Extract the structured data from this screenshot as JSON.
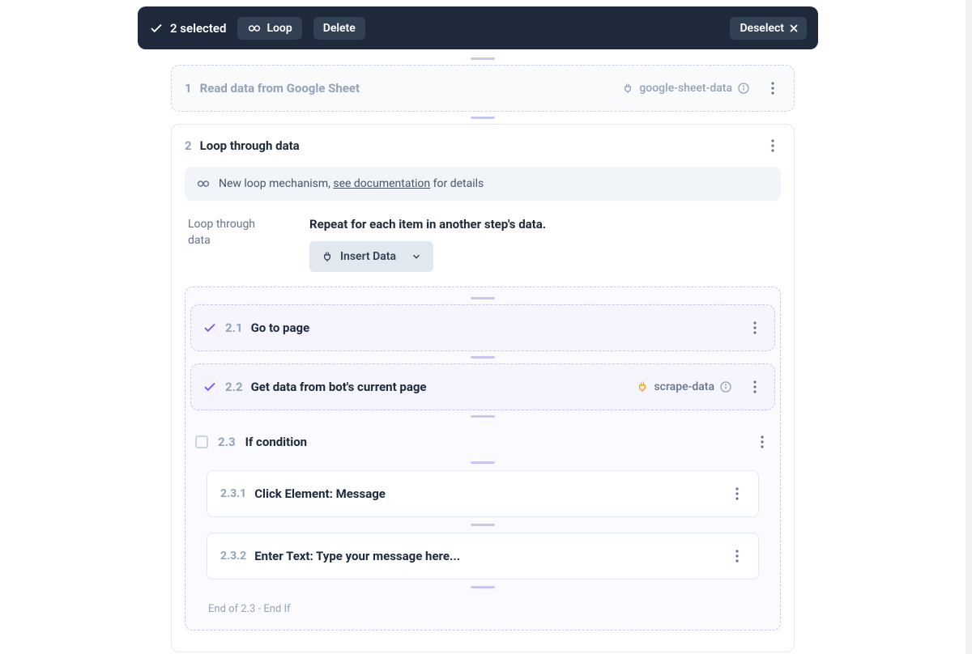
{
  "toolbar": {
    "selected_text": "2 selected",
    "loop_label": "Loop",
    "delete_label": "Delete",
    "deselect_label": "Deselect"
  },
  "step1": {
    "num": "1",
    "title": "Read data from Google Sheet",
    "datatag": "google-sheet-data"
  },
  "step2": {
    "num": "2",
    "title": "Loop through data",
    "notice_prefix": "New loop mechanism, ",
    "notice_link": "see documentation",
    "notice_suffix": " for details",
    "loop_label": "Loop through data",
    "loop_subhead": "Repeat for each item in another step's data.",
    "insert_data_label": "Insert Data",
    "sub1": {
      "num": "2.1",
      "title": "Go to page"
    },
    "sub2": {
      "num": "2.2",
      "title": "Get data from bot's current page",
      "datatag": "scrape-data"
    },
    "if": {
      "num": "2.3",
      "title": "If condition",
      "c1_num": "2.3.1",
      "c1_title": "Click Element: Message",
      "c2_num": "2.3.2",
      "c2_title": "Enter Text: Type your message here...",
      "end": "End of 2.3 - End If"
    }
  }
}
